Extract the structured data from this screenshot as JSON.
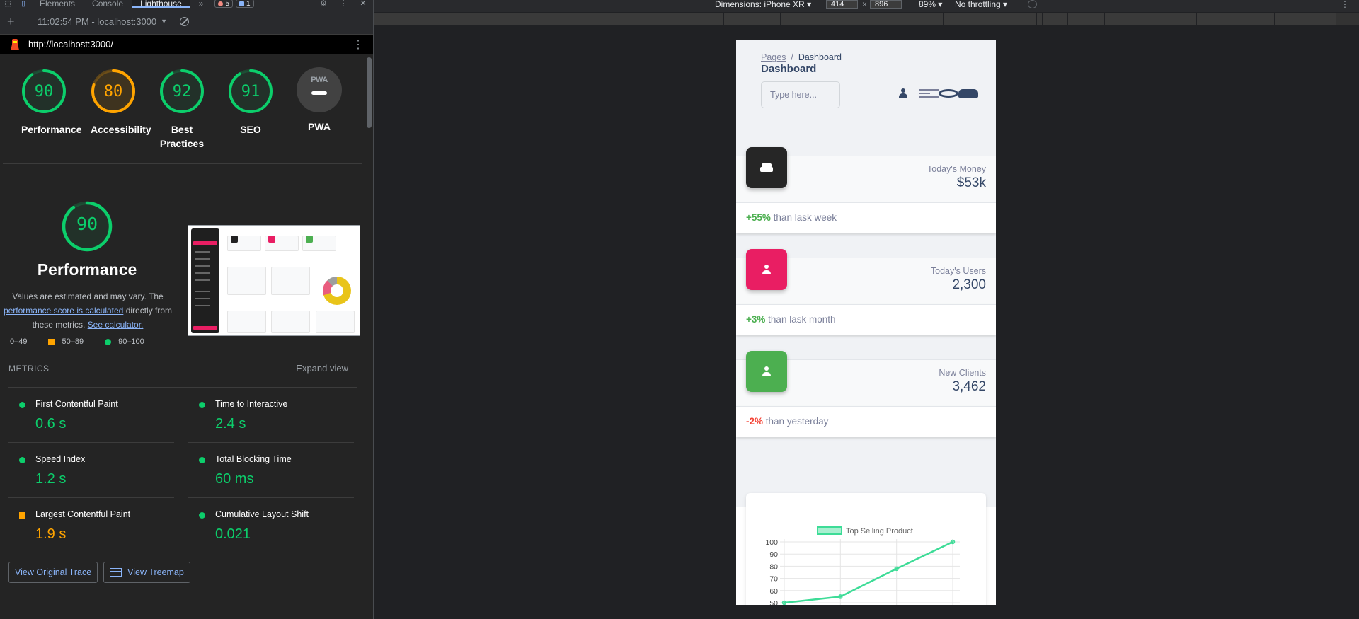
{
  "devtools": {
    "tabs": [
      "Elements",
      "Console",
      "Lighthouse"
    ],
    "more_tabs": "»",
    "error_count": "5",
    "message_count": "1",
    "report_label": "11:02:54 PM - localhost:3000",
    "url": "http://localhost:3000/"
  },
  "categories": [
    {
      "label": "Performance",
      "score": "90",
      "value": 90,
      "color": "#0cce6b"
    },
    {
      "label": "Accessibility",
      "score": "80",
      "value": 80,
      "color": "#ffa400"
    },
    {
      "label": "Best Practices",
      "score": "92",
      "value": 92,
      "color": "#0cce6b"
    },
    {
      "label": "SEO",
      "score": "91",
      "value": 91,
      "color": "#0cce6b"
    },
    {
      "label": "PWA",
      "badge": "PWA"
    }
  ],
  "performance": {
    "score": "90",
    "value": 90,
    "title": "Performance",
    "desc_1": "Values are estimated and may vary. The",
    "desc_link_1": "performance score is calculated",
    "desc_2": "directly from",
    "desc_3": "these metrics.",
    "desc_link_2": "See calculator."
  },
  "legend": [
    {
      "range": "0–49",
      "color": "#ff4e42"
    },
    {
      "range": "50–89",
      "color": "#ffa400"
    },
    {
      "range": "90–100",
      "color": "#0cce6b"
    }
  ],
  "metrics": {
    "heading": "METRICS",
    "expand": "Expand view",
    "items": [
      {
        "name": "First Contentful Paint",
        "value": "0.6 s",
        "color": "#0cce6b",
        "shape": "circle"
      },
      {
        "name": "Time to Interactive",
        "value": "2.4 s",
        "color": "#0cce6b",
        "shape": "circle"
      },
      {
        "name": "Speed Index",
        "value": "1.2 s",
        "color": "#0cce6b",
        "shape": "circle"
      },
      {
        "name": "Total Blocking Time",
        "value": "60 ms",
        "color": "#0cce6b",
        "shape": "circle"
      },
      {
        "name": "Largest Contentful Paint",
        "value": "1.9 s",
        "color": "#ffa400",
        "shape": "square"
      },
      {
        "name": "Cumulative Layout Shift",
        "value": "0.021",
        "color": "#0cce6b",
        "shape": "circle"
      }
    ]
  },
  "actions": {
    "trace": "View Original Trace",
    "treemap": "View Treemap"
  },
  "device_toolbar": {
    "dimensions": "Dimensions: iPhone XR",
    "width": "414",
    "height": "896",
    "zoom": "89%",
    "throttling": "No throttling"
  },
  "app": {
    "breadcrumb_parent": "Pages",
    "breadcrumb_current": "Dashboard",
    "title": "Dashboard",
    "search_placeholder": "Type here...",
    "stats": [
      {
        "label": "Today's Money",
        "value": "$53k",
        "delta": "+55%",
        "delta_color": "#4caf50",
        "suffix": "than lask week",
        "icon_color": "#262626",
        "icon": "sofa"
      },
      {
        "label": "Today's Users",
        "value": "2,300",
        "delta": "+3%",
        "delta_color": "#4caf50",
        "suffix": "than lask month",
        "icon_color": "#e91e63",
        "icon": "person"
      },
      {
        "label": "New Clients",
        "value": "3,462",
        "delta": "-2%",
        "delta_color": "#f44335",
        "suffix": "than yesterday",
        "icon_color": "#4caf50",
        "icon": "person"
      }
    ]
  },
  "chart_data": {
    "type": "line",
    "legend": "Top Selling Product",
    "color": "#3ddc97",
    "y_ticks": [
      100,
      90,
      80,
      70,
      60,
      50
    ],
    "ylim": [
      50,
      100
    ],
    "points": [
      50,
      55,
      78,
      100
    ]
  }
}
